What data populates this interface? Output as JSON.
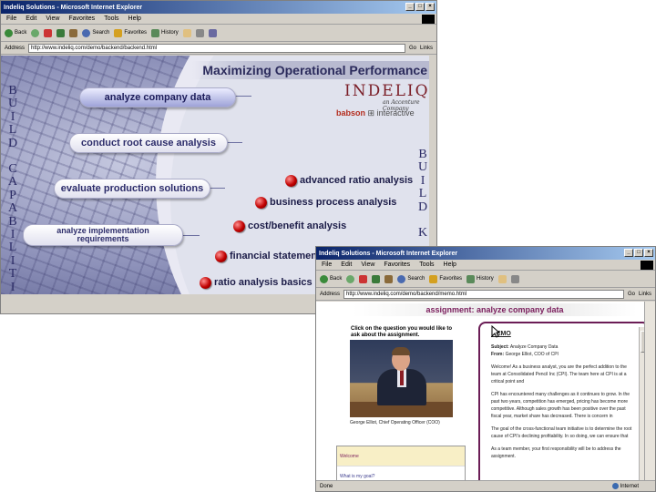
{
  "window1": {
    "title": "Indeliq Solutions - Microsoft Internet Explorer",
    "menu": [
      "File",
      "Edit",
      "View",
      "Favorites",
      "Tools",
      "Help"
    ],
    "toolbar": [
      "Back",
      "Search",
      "Favorites",
      "History"
    ],
    "address_label": "Address",
    "address_url": "http://www.indeliq.com/demo/backend/backend.html",
    "go_label": "Go",
    "links_label": "Links",
    "banner": "Maximizing Operational Performance",
    "logo": "INDELIQ",
    "logo_sub": "an Accenture Company",
    "partner_name": "babson",
    "partner_rest": "interactive",
    "vertical_left": [
      "B",
      "U",
      "I",
      "L",
      "D",
      "",
      "C",
      "A",
      "P",
      "A",
      "B",
      "I",
      "L",
      "I",
      "T",
      "I"
    ],
    "vertical_right": [
      "B",
      "U",
      "I",
      "L",
      "D",
      "",
      "K"
    ],
    "steps": [
      {
        "label": "analyze company data"
      },
      {
        "label": "conduct root cause analysis"
      },
      {
        "label": "evaluate production solutions"
      },
      {
        "line1": "analyze implementation",
        "line2": "requirements"
      }
    ],
    "capabilities": [
      "advanced ratio analysis",
      "business process analysis",
      "cost/benefit analysis",
      "financial statement",
      "ratio analysis basics"
    ]
  },
  "window2": {
    "title": "Indeliq Solutions - Microsoft Internet Explorer",
    "menu": [
      "File",
      "Edit",
      "View",
      "Favorites",
      "Tools",
      "Help"
    ],
    "toolbar": [
      "Back",
      "Search",
      "Favorites",
      "History"
    ],
    "address_label": "Address",
    "address_url": "http://www.indeliq.com/demo/backend/memo.html",
    "go_label": "Go",
    "links_label": "Links",
    "page_header": "assignment: analyze company data",
    "prompt": "Click on the question you would like to ask about the assignment.",
    "photo_caption": "George Elliot, Chief Operating Officer (COO)",
    "questions": [
      "Welcome",
      "What is my goal?"
    ],
    "memo_title": "MEMO",
    "memo_subject_label": "Subject:",
    "memo_subject": "Analyze Company Data",
    "memo_from_label": "From:",
    "memo_from": "George Elliot, COO of CPI",
    "memo_paragraphs": [
      "Welcome! As a business analyst, you are the perfect addition to the team at Consolidated Pencil Inc (CPI). The team here at CPI is at a critical point and",
      "CPI has encountered many challenges as it continues to grow. In the past two years, competition has emerged, pricing has become more competitive. Although sales growth has been positive over the past fiscal year, market share has decreased. There is concern in",
      "The goal of the cross-functional team initiative is to determine the root cause of CPI's declining profitability. In so doing, we can ensure that",
      "As a team member, your first responsibility will be to address the assignment."
    ],
    "status_left": "Done",
    "status_right": "Internet"
  }
}
